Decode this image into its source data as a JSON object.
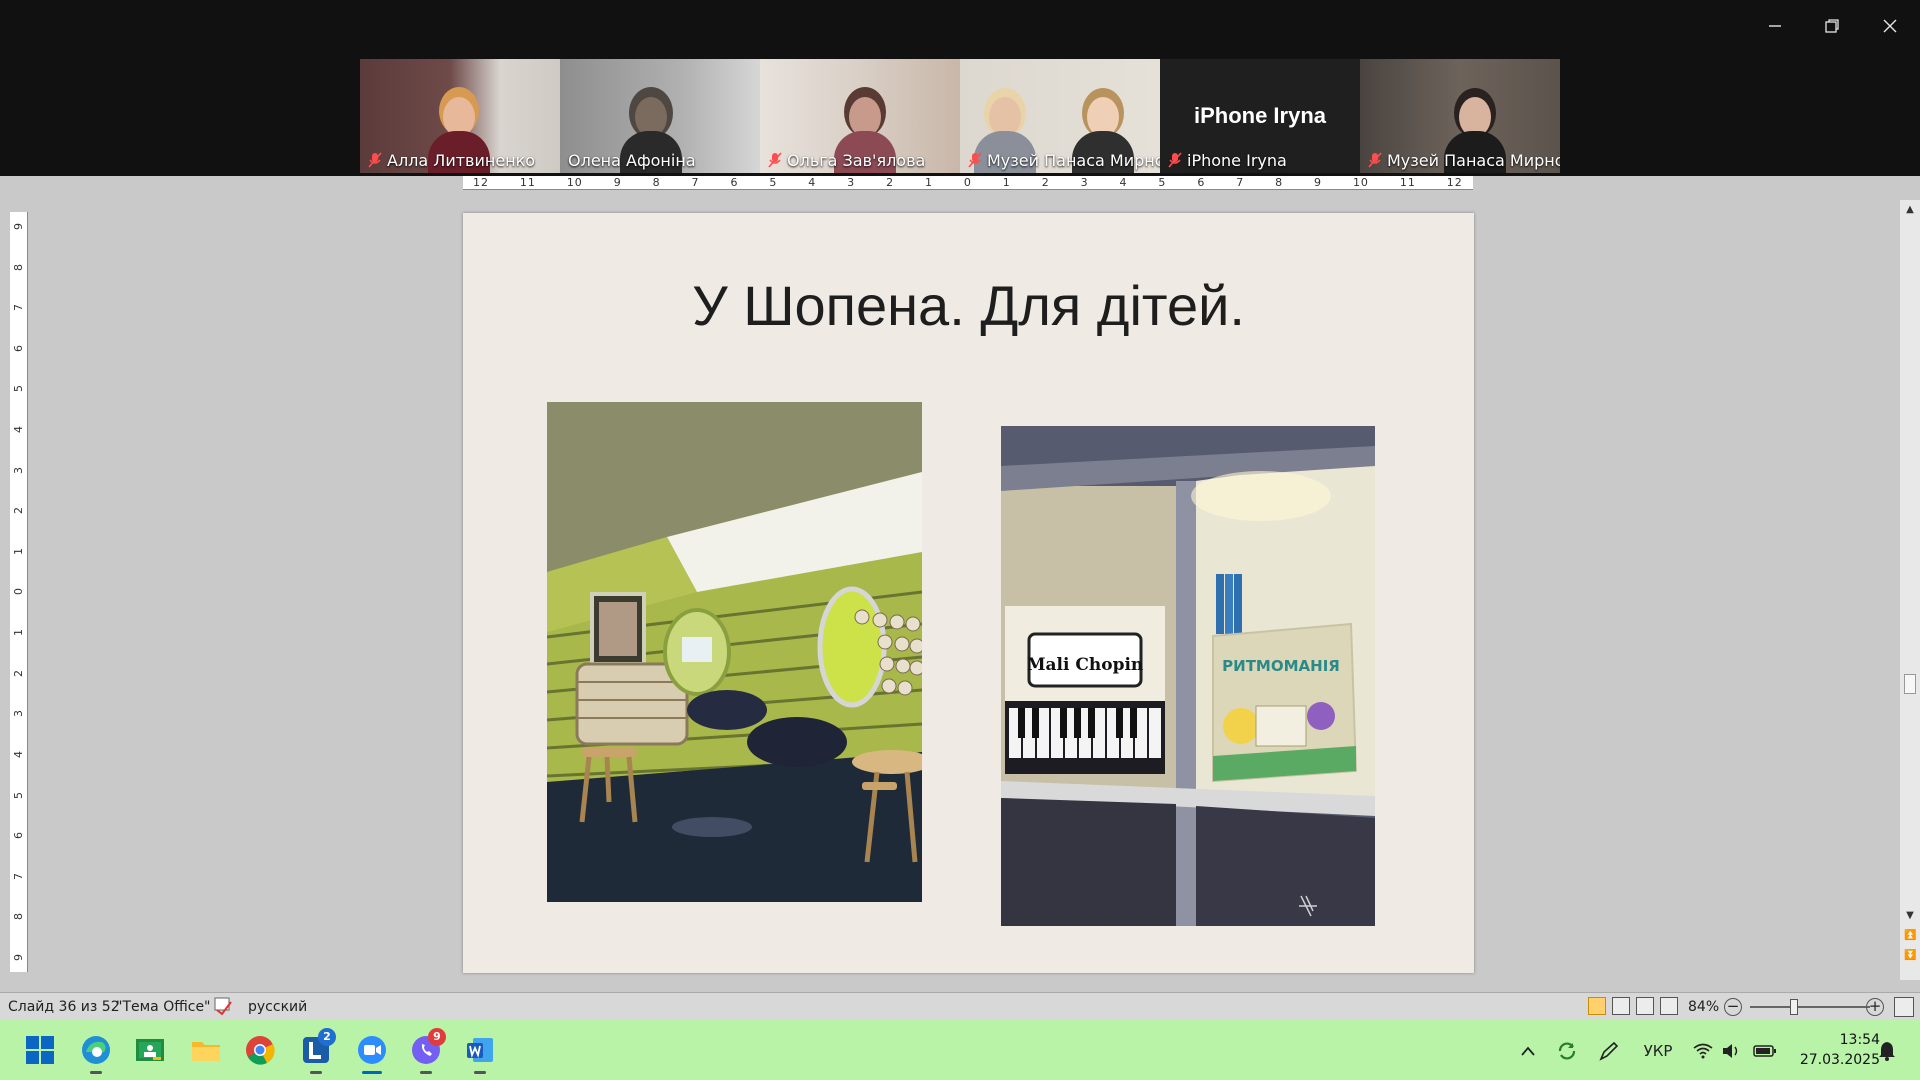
{
  "zoom": {
    "window_controls": {
      "minimize": "minimize",
      "restore": "restore",
      "close": "close"
    },
    "participants": [
      {
        "name": "Алла Литвиненко",
        "muted": true,
        "active": false
      },
      {
        "name": "Олена Афоніна",
        "muted": false,
        "active": true
      },
      {
        "name": "Ольга Зав'ялова",
        "muted": true,
        "active": false
      },
      {
        "name": "Музей Панаса Мирно...",
        "muted": true,
        "active": false
      },
      {
        "name": "iPhone Iryna",
        "muted": true,
        "active": false,
        "video_off_title": "iPhone Iryna"
      },
      {
        "name": "Музей Панаса Мирно...",
        "muted": true,
        "active": false
      }
    ]
  },
  "ruler": {
    "horizontal": [
      "12",
      "11",
      "10",
      "9",
      "8",
      "7",
      "6",
      "5",
      "4",
      "3",
      "2",
      "1",
      "0",
      "1",
      "2",
      "3",
      "4",
      "5",
      "6",
      "7",
      "8",
      "9",
      "10",
      "11",
      "12"
    ],
    "vertical": [
      "9",
      "8",
      "7",
      "6",
      "5",
      "4",
      "3",
      "2",
      "1",
      "0",
      "1",
      "2",
      "3",
      "4",
      "5",
      "6",
      "7",
      "8",
      "9"
    ]
  },
  "slide": {
    "title": "У Шопена. Для дітей.",
    "right_photo_book_left": "Mali Chopin",
    "right_photo_book_right": "РИТМОМАНІЯ"
  },
  "statusbar": {
    "slide_info": "Слайд 36 из 52",
    "theme": "\"Тема Office\"",
    "language": "русский",
    "zoom_level": "84%"
  },
  "taskbar": {
    "apps": [
      "windows-start",
      "edge",
      "google-classroom",
      "file-explorer",
      "chrome",
      "lingvo",
      "zoom",
      "viber",
      "word"
    ],
    "lingvo_badge": "2",
    "viber_badge": "9",
    "language_indicator": "УКР",
    "time": "13:54",
    "date": "27.03.2025"
  },
  "colors": {
    "taskbar_bg": "#b9f3a8",
    "zoom_bg": "#111111",
    "active_speaker": "#2ee86a",
    "slide_bg": "#efebe4"
  }
}
